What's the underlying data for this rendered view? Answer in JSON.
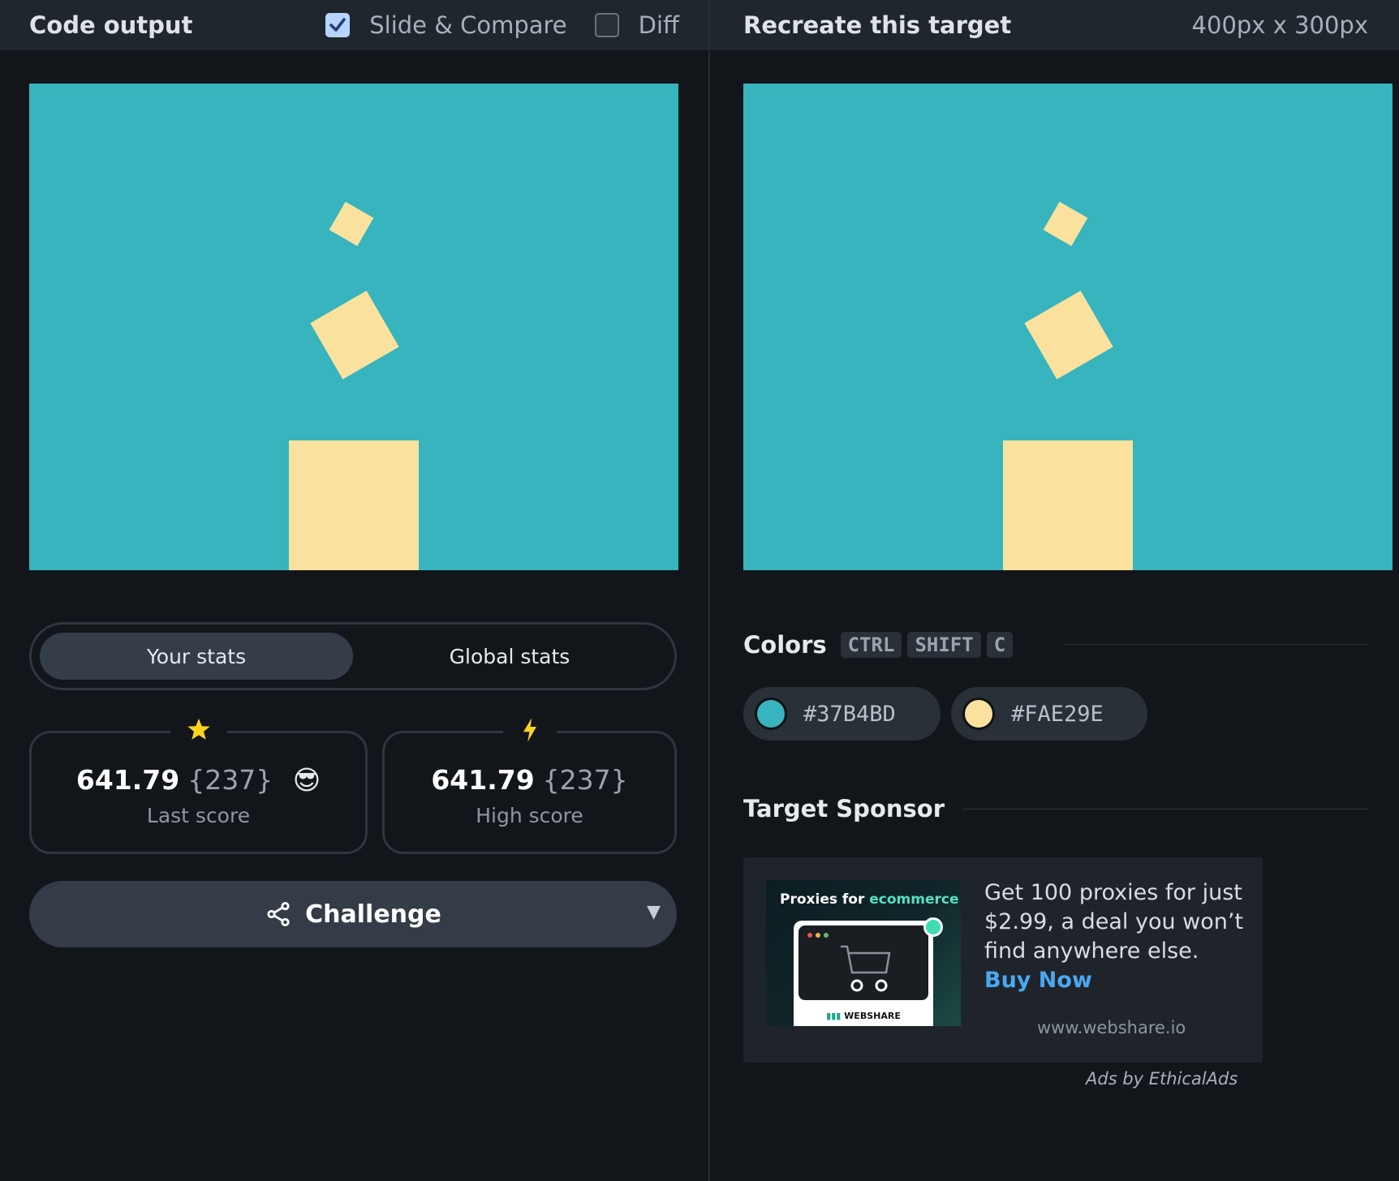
{
  "left_header": {
    "title": "Code output",
    "slide_compare_label": "Slide & Compare",
    "slide_compare_checked": true,
    "diff_label": "Diff",
    "diff_checked": false
  },
  "right_header": {
    "title": "Recreate this target",
    "dimensions": "400px x 300px"
  },
  "canvas": {
    "background": "#37B4BD",
    "shape_color": "#FAE29E"
  },
  "stats_toggle": {
    "your_stats": "Your stats",
    "global_stats": "Global stats",
    "active": "your_stats"
  },
  "last_score": {
    "icon": "star-icon",
    "value": "641.79",
    "count": "{237}",
    "emoji": "😎",
    "label": "Last score"
  },
  "high_score": {
    "icon": "lightning-icon",
    "value": "641.79",
    "count": "{237}",
    "label": "High score"
  },
  "challenge": {
    "label": "Challenge",
    "icon": "share-icon"
  },
  "colors_section": {
    "title": "Colors",
    "shortcut": [
      "CTRL",
      "SHIFT",
      "C"
    ],
    "swatches": [
      {
        "hex": "#37B4BD",
        "label": "#37B4BD"
      },
      {
        "hex": "#FAE29E",
        "label": "#FAE29E"
      }
    ]
  },
  "sponsor": {
    "title": "Target Sponsor",
    "image_headline": "Proxies for",
    "image_headline_highlight": "ecommerce",
    "image_brand": "WEBSHARE",
    "text": "Get 100 proxies for just $2.99, a deal you won’t find anywhere else.",
    "cta": "Buy Now",
    "url": "www.webshare.io",
    "ads_by": "Ads by EthicalAds"
  }
}
